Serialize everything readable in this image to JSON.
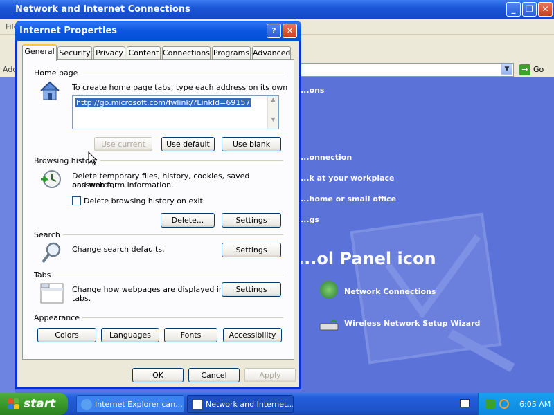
{
  "background_window": {
    "title": "Network and Internet Connections",
    "menu_first": "File",
    "address_label": "Address",
    "go_label": "Go",
    "links": [
      "...ons",
      "...onnection",
      "...k at your workplace",
      "...home or small office",
      "...gs"
    ],
    "pick_heading": "...ol Panel icon",
    "icon_links": [
      "Network Connections",
      "Wireless Network Setup Wizard"
    ]
  },
  "dialog": {
    "title": "Internet Properties",
    "help_glyph": "?",
    "close_glyph": "✕",
    "tabs": [
      "General",
      "Security",
      "Privacy",
      "Content",
      "Connections",
      "Programs",
      "Advanced"
    ],
    "active_tab": "General",
    "home_page": {
      "group_label": "Home page",
      "description": "To create home page tabs, type each address on its own line.",
      "url": "http://go.microsoft.com/fwlink/?LinkId=69157",
      "buttons": [
        "Use current",
        "Use default",
        "Use blank"
      ]
    },
    "browsing_history": {
      "group_label": "Browsing history",
      "description_line1": "Delete temporary files, history, cookies, saved passwords,",
      "description_line2": "and web form information.",
      "checkbox_label": "Delete browsing history on exit",
      "checkbox_checked": false,
      "buttons": [
        "Delete...",
        "Settings"
      ]
    },
    "search": {
      "group_label": "Search",
      "description": "Change search defaults.",
      "button": "Settings"
    },
    "tabs_section": {
      "group_label": "Tabs",
      "description_line1": "Change how webpages are displayed in",
      "description_line2": "tabs.",
      "button": "Settings"
    },
    "appearance": {
      "group_label": "Appearance",
      "buttons": [
        "Colors",
        "Languages",
        "Fonts",
        "Accessibility"
      ]
    },
    "footer_buttons": [
      "OK",
      "Cancel",
      "Apply"
    ]
  },
  "taskbar": {
    "start_label": "start",
    "tasks": [
      "Internet Explorer can...",
      "Network and Internet..."
    ],
    "clock": "6:05 AM"
  },
  "colors": {
    "titlebar_blue": "#0a5fea",
    "taskbar_blue": "#245edb",
    "start_green": "#3a9a2a",
    "dialog_face": "#ece9d8",
    "selection": "#316ac5"
  }
}
